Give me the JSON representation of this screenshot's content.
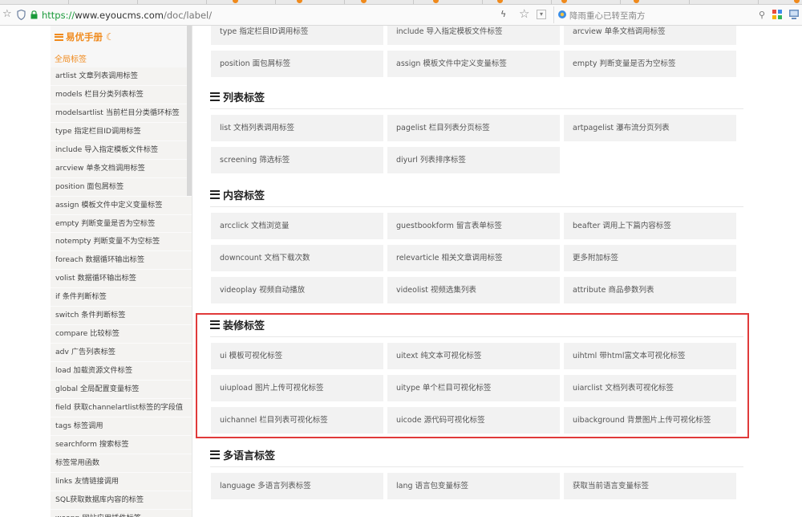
{
  "browser": {
    "url_scheme": "https://",
    "url_host": "www.eyoucms.com",
    "url_path": "/doc/label/",
    "search_placeholder": "降雨重心已转至南方",
    "icons": [
      "star-icon",
      "shield-icon",
      "lock-icon",
      "lightning-icon",
      "favorite-icon",
      "dropdown-icon",
      "search-icon"
    ]
  },
  "sidebar": {
    "title": "易优手册",
    "active_label": "全局标签",
    "items": [
      "artlist 文章列表调用标签",
      "models 栏目分类列表标签",
      "modelsartlist 当前栏目分类循环标签",
      "type 指定栏目ID调用标签",
      "include 导入指定模板文件标签",
      "arcview 单条文档调用标签",
      "position 面包屑标签",
      "assign 模板文件中定义变量标签",
      "empty 判断变量是否为空标签",
      "notempty 判断变量不为空标签",
      "foreach 数据循环输出标签",
      "volist 数据循环输出标签",
      "if 条件判断标签",
      "switch 条件判断标签",
      "compare 比较标签",
      "adv 广告列表标签",
      "load 加载资源文件标签",
      "global 全局配置变量标签",
      "field 获取channelartlist标签的字段值",
      "tags 标签调用",
      "searchform 搜索标签",
      "标签常用函数",
      "links 友情链接调用",
      "SQL获取数据库内容的标签",
      "weapp 网站应用插件标签"
    ]
  },
  "top_rows": [
    [
      "type 指定栏目ID调用标签",
      "include 导入指定模板文件标签",
      "arcview 单条文档调用标签"
    ],
    [
      "position 面包屑标签",
      "assign 模板文件中定义变量标签",
      "empty 判断变量是否为空标签"
    ]
  ],
  "sections": [
    {
      "title": "列表标签",
      "rows": [
        [
          "list 文档列表调用标签",
          "pagelist 栏目列表分页标签",
          "artpagelist 瀑布流分页列表"
        ],
        [
          "screening 筛选标签",
          "diyurl 列表排序标签"
        ]
      ]
    },
    {
      "title": "内容标签",
      "rows": [
        [
          "arcclick 文档浏览量",
          "guestbookform 留言表单标签",
          "beafter 调用上下篇内容标签"
        ],
        [
          "downcount 文档下载次数",
          "relevarticle 相关文章调用标签",
          "更多附加标签"
        ],
        [
          "videoplay 视频自动播放",
          "videolist 视频选集列表",
          "attribute 商品参数列表"
        ]
      ]
    },
    {
      "title": "装修标签",
      "rows": [
        [
          "ui 模板可视化标签",
          "uitext 纯文本可视化标签",
          "uihtml 带html富文本可视化标签"
        ],
        [
          "uiupload 图片上传可视化标签",
          "uitype 单个栏目可视化标签",
          "uiarclist 文档列表可视化标签"
        ],
        [
          "uichannel 栏目列表可视化标签",
          "uicode 源代码可视化标签",
          "uibackground 背景图片上传可视化标签"
        ]
      ]
    },
    {
      "title": "多语言标签",
      "rows": [
        [
          "language 多语言列表标签",
          "lang 语言包变量标签",
          "获取当前语言变量标签"
        ]
      ]
    }
  ],
  "colors": {
    "accent": "#f08a1c",
    "highlight_border": "#e03a3a",
    "cell_bg": "#f2f2f2",
    "url_scheme": "#1a9a3a"
  }
}
